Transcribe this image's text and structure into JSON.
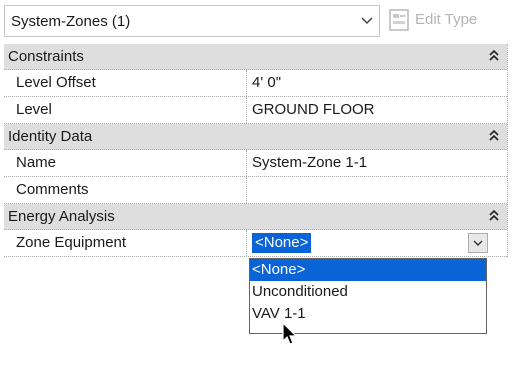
{
  "type_selector": {
    "value": "System-Zones (1)"
  },
  "toolbar": {
    "edit_type_label": "Edit Type"
  },
  "sections": {
    "constraints": {
      "title": "Constraints",
      "rows": [
        {
          "name": "Level Offset",
          "value": "4'  0\""
        },
        {
          "name": "Level",
          "value": "GROUND FLOOR"
        }
      ]
    },
    "identity": {
      "title": "Identity Data",
      "rows": [
        {
          "name": "Name",
          "value": "System-Zone 1-1"
        },
        {
          "name": "Comments",
          "value": ""
        }
      ]
    },
    "energy": {
      "title": "Energy Analysis",
      "rows": [
        {
          "name": "Zone Equipment",
          "value": "<None>"
        }
      ]
    }
  },
  "dropdown": {
    "options": [
      "<None>",
      "Unconditioned",
      "VAV 1-1"
    ],
    "selected_index": 0
  },
  "colors": {
    "selection": "#0a64d6",
    "section_bg": "#dedede"
  },
  "icons": [
    "chevron-down-icon",
    "edit-type-icon",
    "collapse-icon",
    "mouse-cursor-icon"
  ]
}
